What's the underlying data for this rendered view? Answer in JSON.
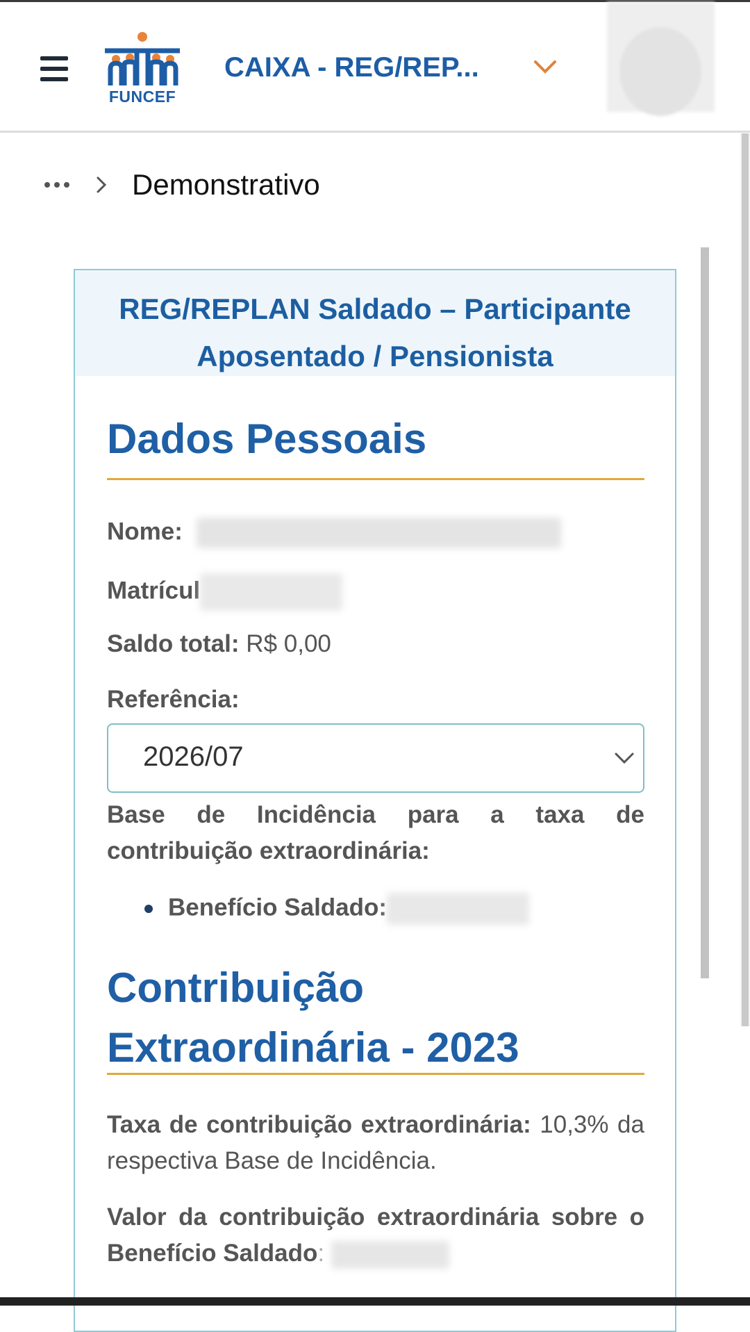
{
  "header": {
    "logo_text": "FUNCEF",
    "org_selector": "CAIXA - REG/REP...",
    "icons": [
      "menu-icon",
      "funcef-logo",
      "chevron-down-icon",
      "avatar"
    ]
  },
  "breadcrumb": {
    "current": "Demonstrativo"
  },
  "card": {
    "title_line1": "REG/REPLAN Saldado – Participante",
    "title_line2": "Aposentado / Pensionista",
    "dados": {
      "section_title": "Dados Pessoais",
      "nome_label": "Nome:",
      "matricula_label": "Matrícul",
      "saldo_label": "Saldo total:",
      "saldo_value": "R$ 0,00",
      "referencia_label": "Referência:",
      "referencia_value": "2026/07",
      "base_label": "Base de Incidência para a taxa de contribuição extraordinária:",
      "beneficio_label": "Benefício Saldado:"
    },
    "contribuicao": {
      "section_title_line1": "Contribuição",
      "section_title_line2": "Extraordinária - 2023",
      "taxa_label": "Taxa de contribuição extraordinária:",
      "taxa_value": "10,3% da respectiva Base de Incidência.",
      "valor_label": "Valor da contribuição extraordinária sobre o Benefício Saldado"
    }
  },
  "colors": {
    "brand_blue": "#1d5da6",
    "accent_orange": "#e0a93a",
    "card_border": "#8fcbd3",
    "card_header_bg": "#eef6fb"
  }
}
